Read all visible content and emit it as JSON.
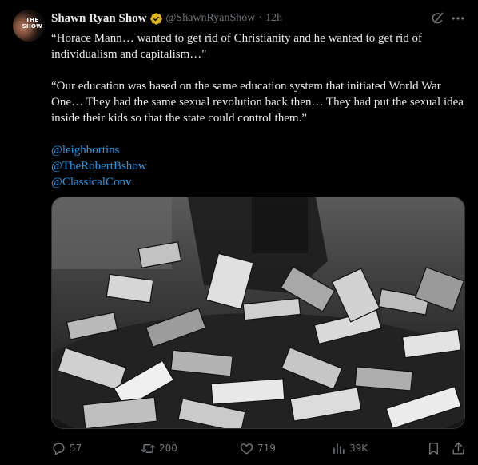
{
  "tweet": {
    "author_name": "Shawn Ryan Show",
    "handle": "@ShawnRyanShow",
    "separator": "·",
    "time": "12h",
    "avatar_text_line1": "THE",
    "avatar_text_line2": "SHOW",
    "paragraph1": "“Horace Mann… wanted to get rid of Christianity and he wanted to get rid of individualism and capitalism…\"",
    "paragraph2": "“Our education was based on the same education system that initiated World War One… They had the same sexual revolution back then… They had put the sexual idea inside their kids so that the state could control them.”",
    "mentions": [
      "@leighbortins",
      "@TheRobertBshow",
      "@ClassicalConv"
    ]
  },
  "actions": {
    "replies": "57",
    "reposts": "200",
    "likes": "719",
    "views": "39K"
  },
  "icons": {
    "verified": "verified-badge-icon",
    "grok": "grok-icon",
    "more": "more-icon",
    "reply": "reply-icon",
    "repost": "repost-icon",
    "like": "heart-icon",
    "views": "views-icon",
    "bookmark": "bookmark-icon",
    "share": "share-icon"
  },
  "colors": {
    "background": "#000000",
    "text": "#e7e9ea",
    "secondary": "#71767b",
    "link": "#1d9bf0",
    "verified_gold": "#e2b719"
  }
}
